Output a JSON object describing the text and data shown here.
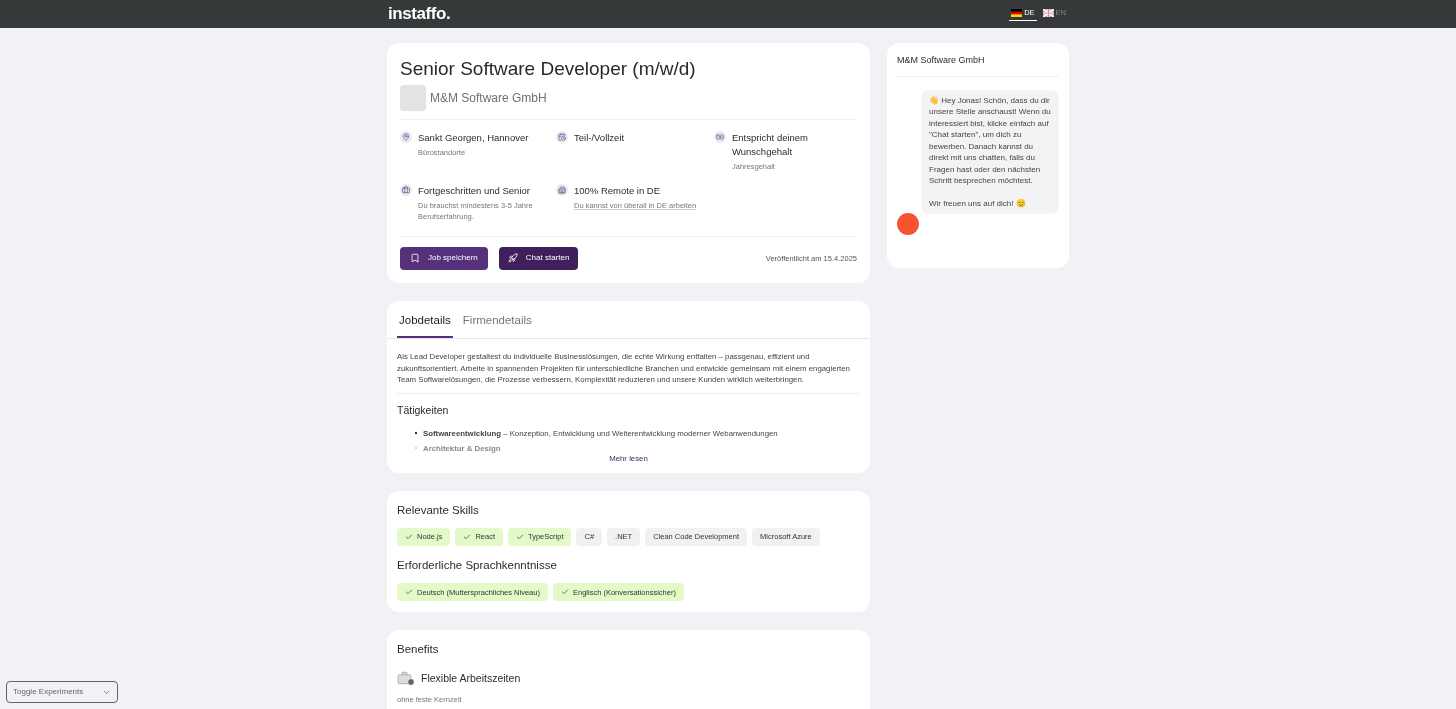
{
  "header": {
    "logo": "instaffo.",
    "languages": [
      {
        "code": "DE",
        "selected": true
      },
      {
        "code": "EN",
        "selected": false
      }
    ]
  },
  "job": {
    "title": "Senior Software Developer (m/w/d)",
    "company": "M&M Software GmbH",
    "facts": [
      {
        "kind": "location",
        "title": "Sankt Georgen, Hannover",
        "subtitle": "Bürostandorte"
      },
      {
        "kind": "time",
        "title": "Teil-/Vollzeit"
      },
      {
        "kind": "salary",
        "title": "Entspricht deinem Wunschgehalt",
        "subtitle": "Jahresgehalt"
      },
      {
        "kind": "level",
        "title": "Fortgeschritten und Senior",
        "subtitle": "Du brauchst mindestens 3-5 Jahre Berufserfahrung."
      },
      {
        "kind": "remote",
        "title": "100% Remote in DE",
        "link": "Du kannst von überall in DE arbeiten"
      }
    ],
    "buttons": [
      {
        "kind": "save",
        "label": "Job speichern"
      },
      {
        "kind": "chat",
        "label": "Chat starten"
      }
    ],
    "published": "Veröffentlicht am 15.4.2025"
  },
  "details": {
    "tabs": [
      {
        "label": "Jobdetails",
        "selected": true
      },
      {
        "label": "Firmendetails",
        "selected": false
      }
    ],
    "intro": "Als Lead Developer gestaltest du individuelle Businesslösungen, die echte Wirkung entfalten – passgenau, effizient und zukunftsorientiert. Arbeite in spannenden Projekten für unterschiedliche Branchen und entwickle gemeinsam mit einem engagierten Team Softwarelösungen, die Prozesse verbessern, Komplexität reduzieren und unsere Kunden wirklich weiterbringen.",
    "section_title": "Tätigkeiten",
    "bullets": [
      {
        "text": "**Softwareentwicklung** – Konzeption, Entwicklung und Weiterentwicklung moderner Webanwendungen",
        "faded": false
      },
      {
        "text": "**Architektur & Design**",
        "faded": true
      }
    ],
    "more": "Mehr lesen"
  },
  "skills": {
    "title": "Relevante Skills",
    "items": [
      {
        "label": "Node.js",
        "matched": true
      },
      {
        "label": "React",
        "matched": true
      },
      {
        "label": "TypeScript",
        "matched": true
      },
      {
        "label": "C#",
        "matched": false
      },
      {
        "label": ".NET",
        "matched": false
      },
      {
        "label": "Clean Code Development",
        "matched": false
      },
      {
        "label": "Microsoft Azure",
        "matched": false
      }
    ],
    "languages_title": "Erforderliche Sprachkenntnisse",
    "languages": [
      {
        "label": "Deutsch (Muttersprachliches Niveau)",
        "matched": true
      },
      {
        "label": "Englisch (Konversationssicher)",
        "matched": true
      }
    ]
  },
  "benefits": {
    "title": "Benefits",
    "items": [
      {
        "title": "Flexible Arbeitszeiten",
        "subtitle": "ohne feste Kernzeit"
      }
    ]
  },
  "chat": {
    "title": "M&M Software GmbH",
    "message": "👋 Hey Jonas! Schön, dass du dir unsere Stelle anschaust! Wenn du interessiert bist, klicke einfach auf \"Chat starten\", um dich zu bewerben. Danach kannst du direkt mit uns chatten, falls du Fragen hast oder den nächsten Schritt besprechen möchtest.",
    "message_closing": "Wir freuen uns auf dich! 😊"
  },
  "experiments": {
    "label": "Toggle Experiments"
  }
}
